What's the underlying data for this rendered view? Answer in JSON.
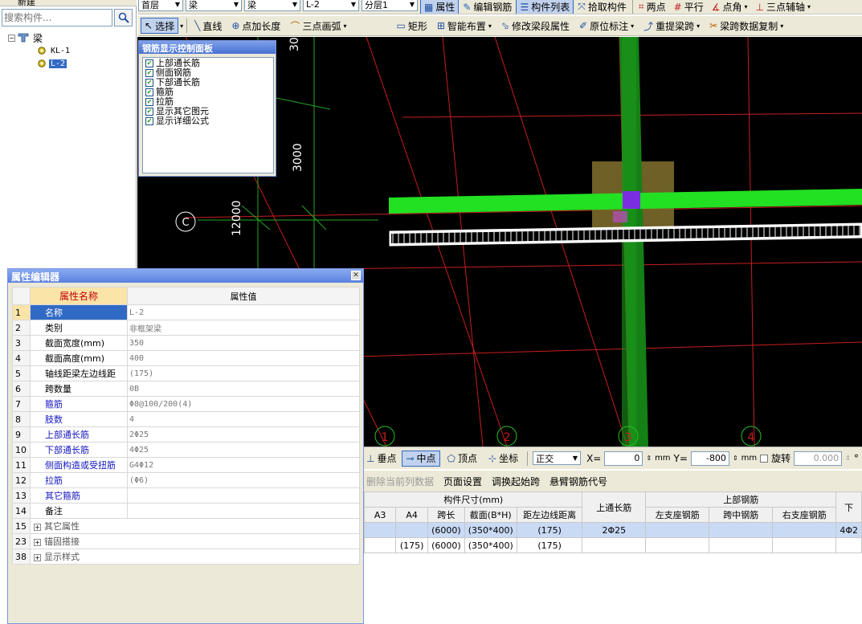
{
  "tree": {
    "top_label": "新建",
    "search_placeholder": "搜索构件...",
    "root": "梁",
    "items": [
      "KL-1",
      "L-2"
    ]
  },
  "toolbar1": {
    "floor": "首层",
    "category": "梁",
    "type": "梁",
    "component": "L-2",
    "layer": "分层1",
    "properties": "属性",
    "edit_rebar": "编辑钢筋",
    "component_list": "构件列表",
    "pick_component": "拾取构件",
    "two_points": "两点",
    "parallel": "平行",
    "point_angle": "点角",
    "three_point_axis": "三点辅轴"
  },
  "toolbar2": {
    "select": "选择",
    "line": "直线",
    "point_length": "点加长度",
    "three_point_arc": "三点画弧",
    "rectangle": "矩形",
    "smart_layout": "智能布置",
    "modify_span_props": "修改梁段属性",
    "original_annotation": "原位标注",
    "re_extract_span": "重提梁跨",
    "copy_span_data": "梁跨数据复制"
  },
  "rebar_panel": {
    "title": "钢筋显示控制面板",
    "items": [
      "上部通长筋",
      "侧面钢筋",
      "下部通长筋",
      "箍筋",
      "拉筋",
      "显示其它图元",
      "显示详细公式"
    ]
  },
  "canvas": {
    "dim_3000": "3000",
    "dim_12000": "12000",
    "dim_top": "30",
    "axis_C": "C",
    "axis_1": "1",
    "axis_2": "2",
    "axis_3": "3",
    "axis_4": "4",
    "colors": {
      "background": "#000000",
      "grid": "#c81e1e",
      "beam": "#22e022",
      "column": "#158015"
    }
  },
  "prop_editor": {
    "title": "属性编辑器",
    "col_name": "属性名称",
    "col_value": "属性值",
    "rows": [
      {
        "num": "1",
        "name": "名称",
        "value": "L-2"
      },
      {
        "num": "2",
        "name": "类别",
        "value": "非框架梁"
      },
      {
        "num": "3",
        "name": "截面宽度(mm)",
        "value": "350"
      },
      {
        "num": "4",
        "name": "截面高度(mm)",
        "value": "400"
      },
      {
        "num": "5",
        "name": "轴线距梁左边线距",
        "value": "(175)"
      },
      {
        "num": "6",
        "name": "跨数量",
        "value": "0B"
      },
      {
        "num": "7",
        "name": "箍筋",
        "value": "Φ8@100/200(4)"
      },
      {
        "num": "8",
        "name": "肢数",
        "value": "4"
      },
      {
        "num": "9",
        "name": "上部通长筋",
        "value": "2Φ25"
      },
      {
        "num": "10",
        "name": "下部通长筋",
        "value": "4Φ25"
      },
      {
        "num": "11",
        "name": "侧面构造或受扭筋",
        "value": "G4Φ12"
      },
      {
        "num": "12",
        "name": "拉筋",
        "value": "(Φ6)"
      },
      {
        "num": "13",
        "name": "其它箍筋",
        "value": ""
      },
      {
        "num": "14",
        "name": "备注",
        "value": ""
      },
      {
        "num": "15",
        "name": "其它属性",
        "value": ""
      },
      {
        "num": "23",
        "name": "锚固搭接",
        "value": ""
      },
      {
        "num": "38",
        "name": "显示样式",
        "value": ""
      }
    ]
  },
  "statusbar": {
    "perpendicular": "垂点",
    "midpoint": "中点",
    "vertex": "顶点",
    "coordinate": "坐标",
    "mode": "正交",
    "x_label": "X=",
    "x_value": "0",
    "y_label": "Y=",
    "y_value": "-800",
    "unit": "mm",
    "rotate": "旋转",
    "rotate_value": "0.000",
    "degree": "°"
  },
  "bottom_toolbar": {
    "delete_column": "删除当前列数据",
    "page_setup": "页面设置",
    "swap_start": "调换起始跨",
    "cantilever_code": "悬臂钢筋代号"
  },
  "grid": {
    "group_size": "构件尺寸(mm)",
    "col_top_long": "上通长筋",
    "group_top": "上部钢筋",
    "col_a3": "A3",
    "col_a4": "A4",
    "col_span": "跨长",
    "col_section": "截面(B*H)",
    "col_offset": "距左边线距离",
    "col_left_support": "左支座钢筋",
    "col_mid": "跨中钢筋",
    "col_right_support": "右支座钢筋",
    "col_next": "下",
    "rows": [
      {
        "a3": "",
        "a4": "",
        "span": "(6000)",
        "section": "(350*400)",
        "offset": "(175)",
        "top_long": "2Φ25",
        "left": "",
        "mid": "",
        "right": "",
        "next": "4Φ2"
      },
      {
        "a3": "",
        "a4": "(175)",
        "span": "(6000)",
        "section": "(350*400)",
        "offset": "(175)",
        "top_long": "",
        "left": "",
        "mid": "",
        "right": "",
        "next": ""
      }
    ]
  }
}
